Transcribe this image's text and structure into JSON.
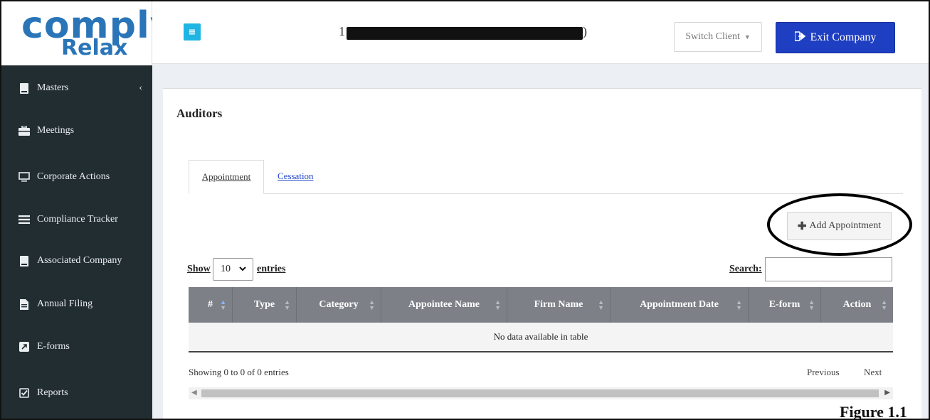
{
  "logo": {
    "line1": "comply",
    "line2": "Relax"
  },
  "sidebar": {
    "items": [
      {
        "label": "Masters",
        "icon": "book-icon",
        "has_chevron": true
      },
      {
        "label": "Meetings",
        "icon": "briefcase-icon"
      },
      {
        "label": "Corporate Actions",
        "icon": "monitor-icon"
      },
      {
        "label": "Compliance Tracker",
        "icon": "list-icon"
      },
      {
        "label": "Associated Company",
        "icon": "book-icon"
      },
      {
        "label": "Annual Filing",
        "icon": "file-icon"
      },
      {
        "label": "E-forms",
        "icon": "external-link-icon"
      },
      {
        "label": "Reports",
        "icon": "check-square-icon"
      }
    ],
    "chevron": "‹"
  },
  "topbar": {
    "menu_icon": "≡",
    "company_prefix": "1",
    "company_suffix": ")",
    "switch_label": "Switch Client",
    "exit_label": "Exit Company"
  },
  "page": {
    "title": "Auditors",
    "tabs": [
      {
        "label": "Appointment",
        "active": true
      },
      {
        "label": "Cessation",
        "active": false
      }
    ],
    "add_button": "Add Appointment"
  },
  "table": {
    "show_label": "Show",
    "entries_value": "10",
    "entries_label": "entries",
    "search_label": "Search:",
    "columns": [
      "#",
      "Type",
      "Category",
      "Appointee Name",
      "Firm Name",
      "Appointment Date",
      "E-form",
      "Action"
    ],
    "empty_text": "No data available in table",
    "info": "Showing 0 to 0 of 0 entries",
    "prev": "Previous",
    "next": "Next"
  },
  "figure_caption": "Figure 1.1",
  "colors": {
    "sidebar_bg": "#222d32",
    "accent_blue": "#1f3fc2",
    "menu_button": "#1fb5e3",
    "logo_blue": "#2a74b8",
    "table_header": "#7d8187"
  }
}
